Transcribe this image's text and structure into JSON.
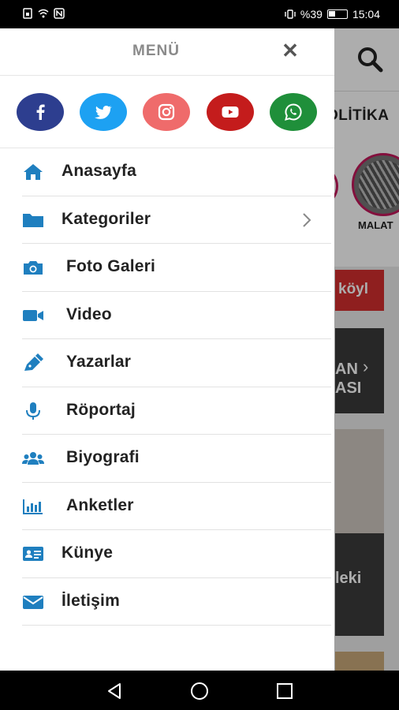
{
  "status_bar": {
    "battery_text": "%39",
    "time": "15:04"
  },
  "background": {
    "visible_tab": "OLİTİKA",
    "story_label": "MALAT",
    "red_banner_text": "köyl",
    "card1_text_line1": "AN",
    "card1_text_line2": "ASI",
    "card2_text": "leki"
  },
  "drawer": {
    "title": "MENÜ",
    "close_symbol": "✕",
    "socials": [
      {
        "name": "facebook",
        "color": "#2d3e8f"
      },
      {
        "name": "twitter",
        "color": "#1da1f2"
      },
      {
        "name": "instagram",
        "color": "#ef6b6b"
      },
      {
        "name": "youtube",
        "color": "#c41c1c"
      },
      {
        "name": "whatsapp",
        "color": "#1f8f3a"
      }
    ],
    "items": [
      {
        "label": "Anasayfa",
        "icon": "home-icon"
      },
      {
        "label": "Kategoriler",
        "icon": "folder-icon",
        "has_chevron": true
      },
      {
        "label": "Foto Galeri",
        "icon": "camera-icon"
      },
      {
        "label": "Video",
        "icon": "video-icon"
      },
      {
        "label": "Yazarlar",
        "icon": "pen-icon"
      },
      {
        "label": "Röportaj",
        "icon": "microphone-icon"
      },
      {
        "label": "Biyografi",
        "icon": "users-icon"
      },
      {
        "label": "Anketler",
        "icon": "bar-chart-icon"
      },
      {
        "label": "Künye",
        "icon": "id-card-icon"
      },
      {
        "label": "İletişim",
        "icon": "envelope-icon"
      }
    ]
  },
  "colors": {
    "menu_icon": "#1f7fbf",
    "divider": "#e2e2e2"
  }
}
